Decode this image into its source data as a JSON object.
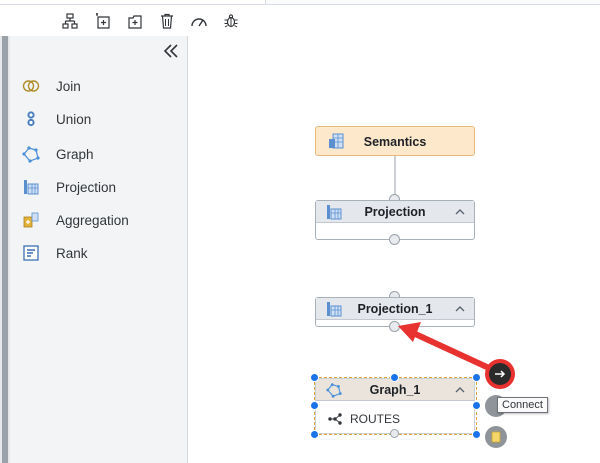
{
  "palette": {
    "items": [
      {
        "label": "Join",
        "icon": "join-icon"
      },
      {
        "label": "Union",
        "icon": "union-icon"
      },
      {
        "label": "Graph",
        "icon": "graph-icon"
      },
      {
        "label": "Projection",
        "icon": "projection-icon"
      },
      {
        "label": "Aggregation",
        "icon": "aggregation-icon"
      },
      {
        "label": "Rank",
        "icon": "rank-icon"
      }
    ],
    "collapse_icon": "double-chevron-left-icon"
  },
  "toolbar": {
    "icons": [
      "auto-layout-icon",
      "add-node-icon",
      "add-node-alt-icon",
      "delete-icon",
      "performance-icon",
      "debug-icon"
    ]
  },
  "canvas": {
    "nodes": {
      "semantics": {
        "title": "Semantics"
      },
      "projection": {
        "title": "Projection"
      },
      "projection_1": {
        "title": "Projection_1"
      },
      "graph_1": {
        "title": "Graph_1",
        "row_label": "ROUTES"
      }
    },
    "tooltip": "Connect"
  },
  "colors": {
    "semantics_fill": "#fde8cc",
    "node_header": "#e4e8ec",
    "selection_handle": "#1a73e8",
    "annotation_arrow": "#e8322f",
    "connect_button": "#2b2b2b"
  }
}
